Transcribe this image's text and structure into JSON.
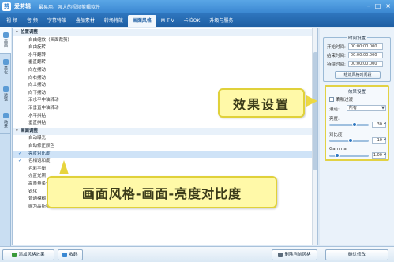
{
  "window": {
    "app_name": "爱剪辑",
    "subtitle": "最易用、强大的视频剪辑软件",
    "controls": [
      "–",
      "□",
      "×"
    ]
  },
  "tabs": [
    {
      "label": "视 频",
      "active": false
    },
    {
      "label": "音 频",
      "active": false
    },
    {
      "label": "字幕特效",
      "active": false
    },
    {
      "label": "叠加素材",
      "active": false
    },
    {
      "label": "转场特效",
      "active": false
    },
    {
      "label": "画面风格",
      "active": true
    },
    {
      "label": "M T V",
      "active": false
    },
    {
      "label": "卡拉OK",
      "active": false
    },
    {
      "label": "升级与服务",
      "active": false
    }
  ],
  "side_tabs": [
    {
      "label": "画面",
      "icon": "picture-icon",
      "active": true
    },
    {
      "label": "美化",
      "icon": "sparkle-icon",
      "active": false
    },
    {
      "label": "滤镜",
      "icon": "filter-icon",
      "active": false
    },
    {
      "label": "动景",
      "icon": "motion-icon",
      "active": false
    }
  ],
  "effects_list": [
    {
      "type": "category",
      "label": "位置调整"
    },
    {
      "type": "item",
      "label": "自由缩放（画面裁剪）",
      "checked": false
    },
    {
      "type": "item",
      "label": "自由旋转",
      "checked": false
    },
    {
      "type": "item",
      "label": "水平翻转",
      "checked": false
    },
    {
      "type": "item",
      "label": "垂直翻转",
      "checked": false
    },
    {
      "type": "item",
      "label": "向左摆动",
      "checked": false
    },
    {
      "type": "item",
      "label": "向右摆动",
      "checked": false
    },
    {
      "type": "item",
      "label": "向上摆动",
      "checked": false
    },
    {
      "type": "item",
      "label": "向下摆动",
      "checked": false
    },
    {
      "type": "item",
      "label": "沿水平中轴转动",
      "checked": false
    },
    {
      "type": "item",
      "label": "沿垂直中轴转动",
      "checked": false
    },
    {
      "type": "item",
      "label": "水平拼贴",
      "checked": false
    },
    {
      "type": "item",
      "label": "垂直拼贴",
      "checked": false
    },
    {
      "type": "category",
      "label": "画面调整"
    },
    {
      "type": "item",
      "label": "自动曝光",
      "checked": false
    },
    {
      "type": "item",
      "label": "自动修正颜色",
      "checked": false
    },
    {
      "type": "item",
      "label": "亮度对比度",
      "checked": true,
      "selected": true
    },
    {
      "type": "item",
      "label": "色相饱和度",
      "checked": true
    },
    {
      "type": "item",
      "label": "色彩平衡",
      "checked": false
    },
    {
      "type": "item",
      "label": "亦置光照",
      "checked": false
    },
    {
      "type": "item",
      "label": "高质量柔化",
      "checked": false
    },
    {
      "type": "item",
      "label": "锐化",
      "checked": false
    },
    {
      "type": "item",
      "label": "普通模糊",
      "checked": false
    },
    {
      "type": "item",
      "label": "缩为高斯模糊",
      "checked": false
    }
  ],
  "callouts": {
    "effect_settings": "效果设置",
    "style_path": "画面风格-画面-亮度对比度"
  },
  "time_settings": {
    "title": "时间设置",
    "start_label": "开始时间:",
    "start_value": "00:00:00.000",
    "end_label": "结束时间:",
    "end_value": "00:00:00.000",
    "duration_label": "持续时间:",
    "duration_value": "00:00:00.000",
    "apply_button": "组效风格时间段"
  },
  "effect_settings": {
    "title": "效果设置",
    "soft_transition_label": "柔和过渡",
    "soft_transition_checked": false,
    "channel_label": "通道:",
    "channel_value": "所有",
    "brightness_label": "亮度:",
    "brightness_value": "30",
    "brightness_level": 0.65,
    "contrast_label": "对比度:",
    "contrast_value": "10",
    "contrast_level": 0.55,
    "gamma_label": "Gamma:",
    "gamma_value": "1.00",
    "gamma_level": 0.15
  },
  "bottom_bar": {
    "add_style_button": "添加风格效果",
    "collapse_button": "收起",
    "delete_style_button": "删除当前风格",
    "confirm_button": "确认修改"
  }
}
